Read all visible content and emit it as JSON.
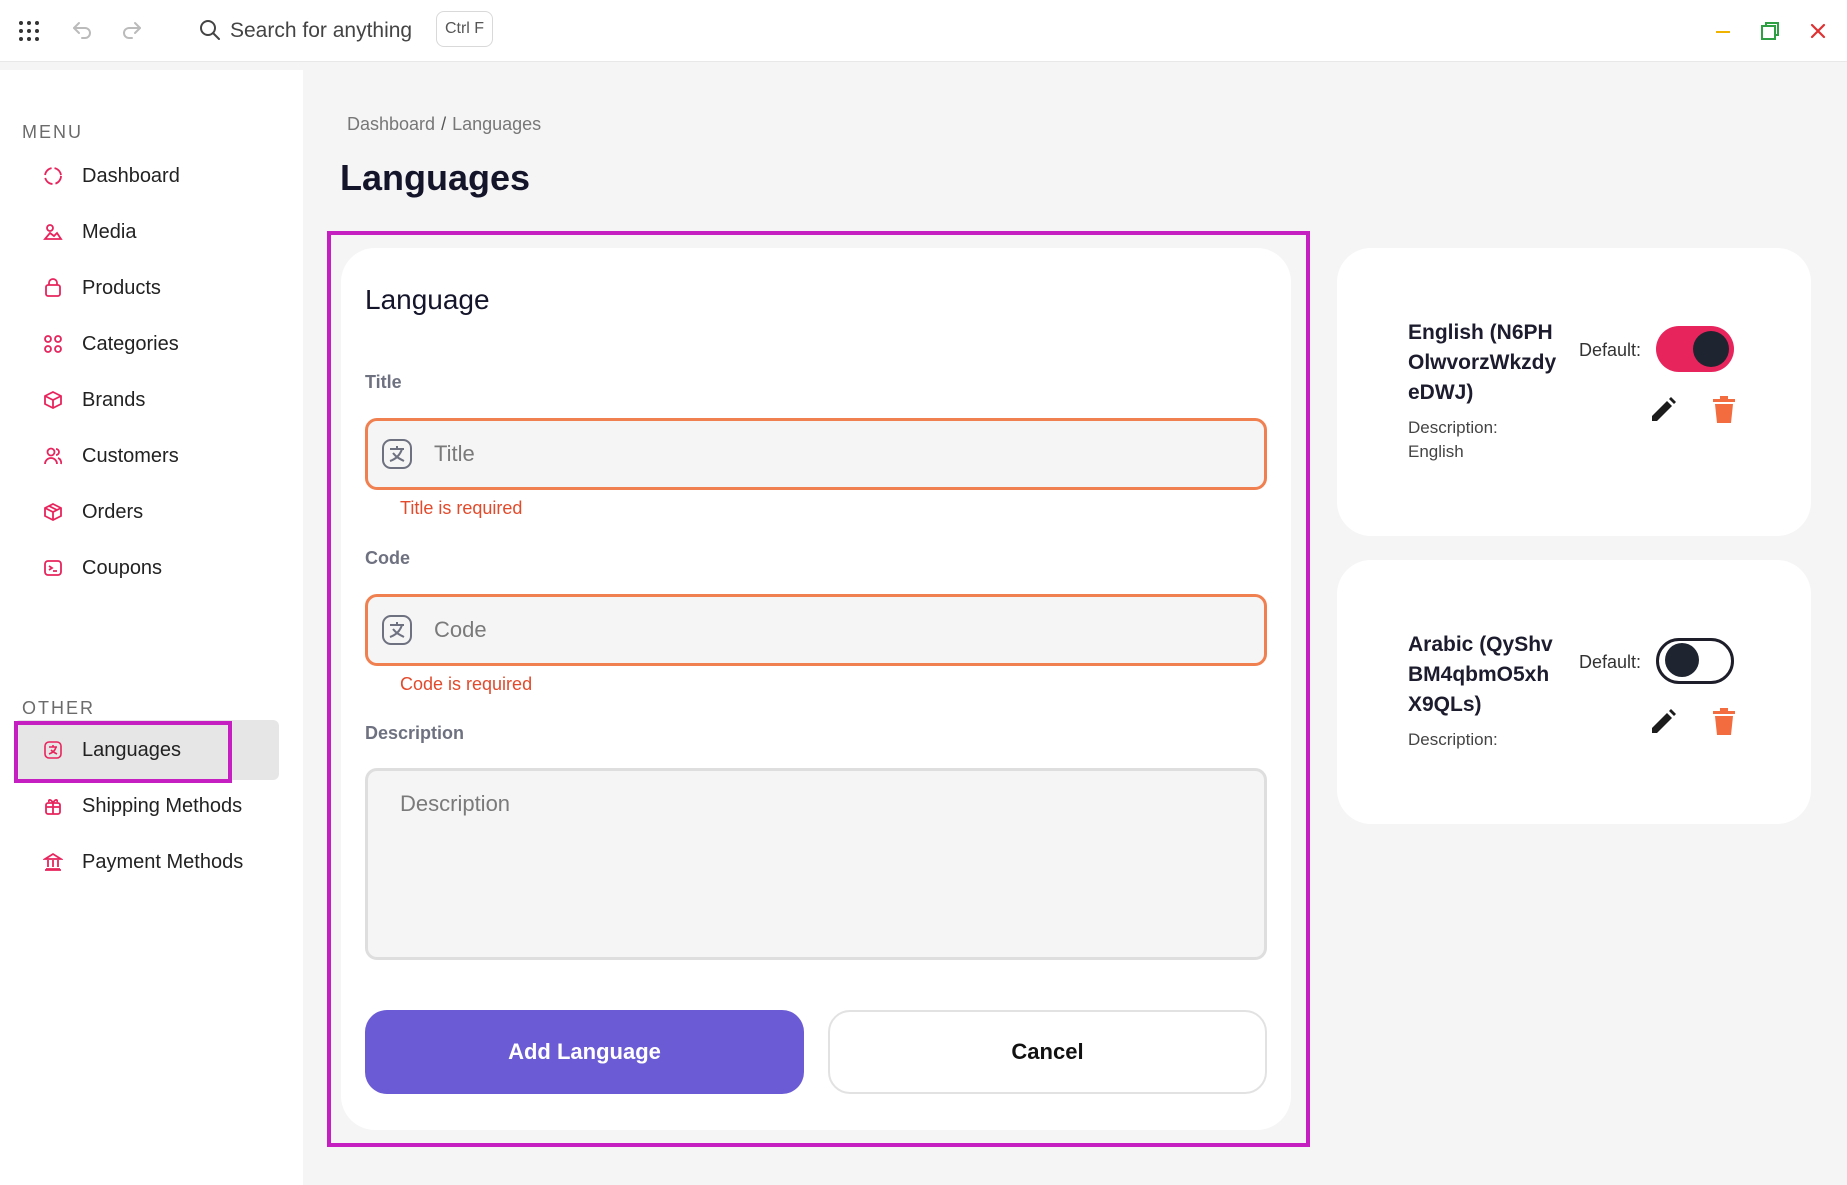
{
  "topbar": {
    "search_placeholder": "Search for anything",
    "shortcut_hint": "Ctrl F"
  },
  "sidebar": {
    "menu_label": "MENU",
    "other_label": "OTHER",
    "menu_items": [
      {
        "label": "Dashboard",
        "icon": "dashboard-icon"
      },
      {
        "label": "Media",
        "icon": "media-icon"
      },
      {
        "label": "Products",
        "icon": "products-icon"
      },
      {
        "label": "Categories",
        "icon": "categories-icon"
      },
      {
        "label": "Brands",
        "icon": "brands-icon"
      },
      {
        "label": "Customers",
        "icon": "customers-icon"
      },
      {
        "label": "Orders",
        "icon": "orders-icon"
      },
      {
        "label": "Coupons",
        "icon": "coupons-icon"
      }
    ],
    "other_items": [
      {
        "label": "Languages",
        "icon": "languages-icon",
        "active": true
      },
      {
        "label": "Shipping Methods",
        "icon": "shipping-icon"
      },
      {
        "label": "Payment Methods",
        "icon": "payment-icon"
      }
    ]
  },
  "breadcrumb": {
    "home": "Dashboard",
    "separator": "/",
    "current": "Languages"
  },
  "page": {
    "title": "Languages"
  },
  "form": {
    "heading": "Language",
    "title_label": "Title",
    "title_placeholder": "Title",
    "title_value": "",
    "title_error": "Title is required",
    "code_label": "Code",
    "code_placeholder": "Code",
    "code_value": "",
    "code_error": "Code is required",
    "description_label": "Description",
    "description_placeholder": "Description",
    "description_value": "",
    "submit_label": "Add Language",
    "cancel_label": "Cancel"
  },
  "languages": [
    {
      "name": "English (N6PHOlwvorzWkzdyeDWJ)",
      "description_label": "Description:",
      "description_value": "English",
      "default_label": "Default:",
      "is_default": true
    },
    {
      "name": "Arabic (QyShvBM4qbmO5xhX9QLs)",
      "description_label": "Description:",
      "description_value": "",
      "default_label": "Default:",
      "is_default": false
    }
  ],
  "colors": {
    "accent": "#6b5bd4",
    "toggle_on": "#e8245d",
    "error": "#e24a2b",
    "highlight": "#c51fc1",
    "icon_pink": "#e8245d",
    "delete_orange": "#f36c3f"
  }
}
